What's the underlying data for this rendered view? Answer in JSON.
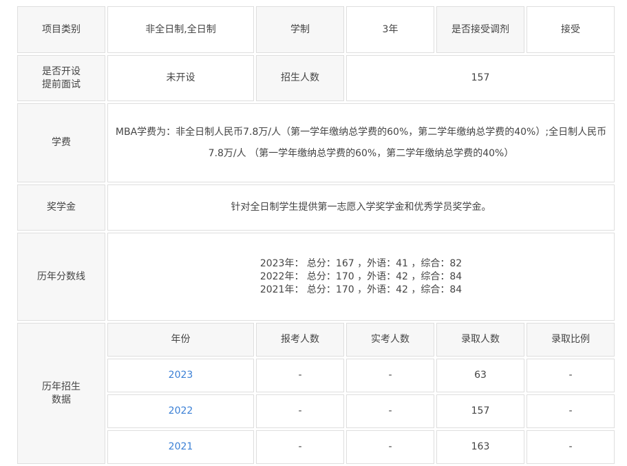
{
  "rows": {
    "r1": {
      "category_label": "项目类别",
      "category_value": "非全日制,全日制",
      "duration_label": "学制",
      "duration_value": "3年",
      "adjust_label": "是否接受调剂",
      "adjust_value": "接受"
    },
    "r2": {
      "interview_label_line1": "是否开设",
      "interview_label_line2": "提前面试",
      "interview_value": "未开设",
      "enrollment_label": "招生人数",
      "enrollment_value": "157"
    },
    "tuition": {
      "label": "学费",
      "text_line1": "MBA学费为：非全日制人民币7.8万/人（第一学年缴纳总学费的60%，第二学年缴纳总学费的40%）;全日制人民币",
      "text_line2": "7.8万/人 （第一学年缴纳总学费的60%，第二学年缴纳总学费的40%）"
    },
    "scholarship": {
      "label": "奖学金",
      "text": "针对全日制学生提供第一志愿入学奖学金和优秀学员奖学金。"
    },
    "scores": {
      "label": "历年分数线",
      "lines": [
        "2023年： 总分：167 ，外语：41 ，综合：82",
        "2022年： 总分：170 ，外语：42 ，综合：84",
        "2021年： 总分：170 ，外语：42 ，综合：84"
      ]
    },
    "history": {
      "label_line1": "历年招生",
      "label_line2": "数据",
      "headers": [
        "年份",
        "报考人数",
        "实考人数",
        "录取人数",
        "录取比例"
      ],
      "rows": [
        {
          "year": "2023",
          "applicants": "-",
          "examinees": "-",
          "admitted": "63",
          "ratio": "-"
        },
        {
          "year": "2022",
          "applicants": "-",
          "examinees": "-",
          "admitted": "157",
          "ratio": "-"
        },
        {
          "year": "2021",
          "applicants": "-",
          "examinees": "-",
          "admitted": "163",
          "ratio": "-"
        }
      ]
    }
  },
  "colors": {
    "border": "#dedede",
    "label_bg": "#f7f7f7",
    "link": "#3a7fd5",
    "text": "#444444"
  }
}
